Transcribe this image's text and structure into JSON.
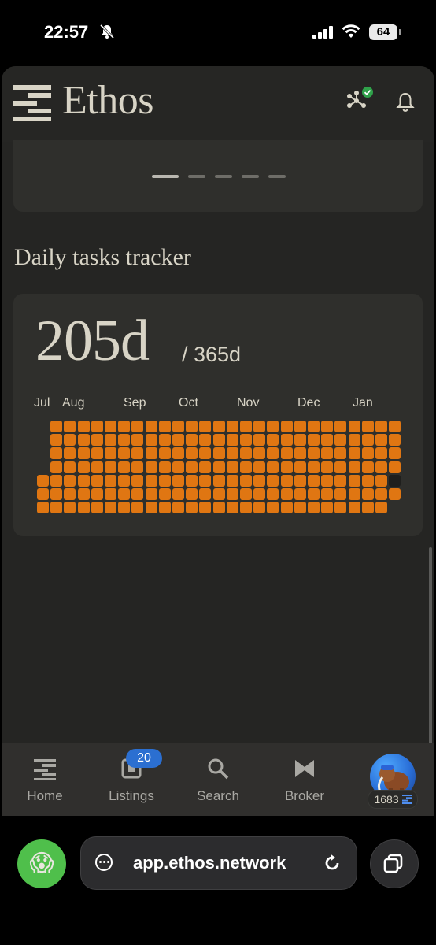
{
  "status_bar": {
    "time": "22:57",
    "battery": "64"
  },
  "header": {
    "logo_text": "Ethos"
  },
  "carousel": {
    "page_count": 5,
    "active_index": 0
  },
  "tracker": {
    "section_title": "Daily tasks tracker",
    "days_completed": "205d",
    "days_total": "/ 365d",
    "months": [
      "Jul",
      "Aug",
      "Sep",
      "Oct",
      "Nov",
      "Dec",
      "Jan"
    ],
    "accent_color": "#e07612",
    "empty_color": "#1f1f1d"
  },
  "bottom_nav": {
    "items": [
      {
        "label": "Home",
        "icon": "ethos-logo-icon"
      },
      {
        "label": "Listings",
        "icon": "listings-icon"
      },
      {
        "label": "Search",
        "icon": "search-icon"
      },
      {
        "label": "Broker",
        "icon": "broker-icon"
      }
    ],
    "listings_badge": "20",
    "profile_points": "1683"
  },
  "browser": {
    "emoji": "😱",
    "url": "app.ethos.network"
  }
}
